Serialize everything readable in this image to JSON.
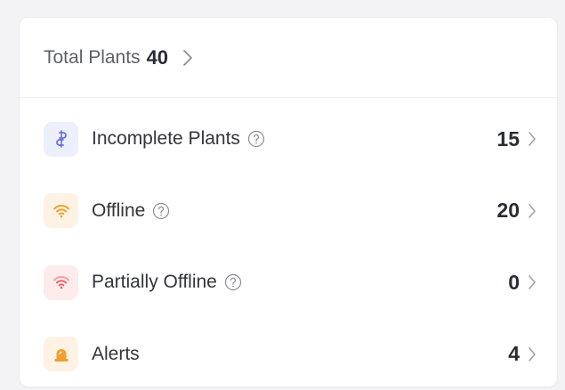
{
  "summary": {
    "label": "Total Plants",
    "count": "40"
  },
  "rows": [
    {
      "label": "Incomplete Plants",
      "value": "15",
      "icon": "plug-icon",
      "color": "#6b6fe0",
      "bg": "#eeeffc",
      "help": true
    },
    {
      "label": "Offline",
      "value": "20",
      "icon": "wifi-icon",
      "color": "#f0a030",
      "bg": "#fdf2e3",
      "help": true
    },
    {
      "label": "Partially Offline",
      "value": "0",
      "icon": "wifi-weak-icon",
      "color": "#e8646b",
      "bg": "#fdeceb",
      "help": true
    },
    {
      "label": "Alerts",
      "value": "4",
      "icon": "alarm-icon",
      "color": "#f0a030",
      "bg": "#fdf2e3",
      "help": false
    }
  ],
  "colors": {
    "text_primary": "#2a2c33",
    "text_secondary": "#5f6168",
    "divider": "#efeff2"
  }
}
